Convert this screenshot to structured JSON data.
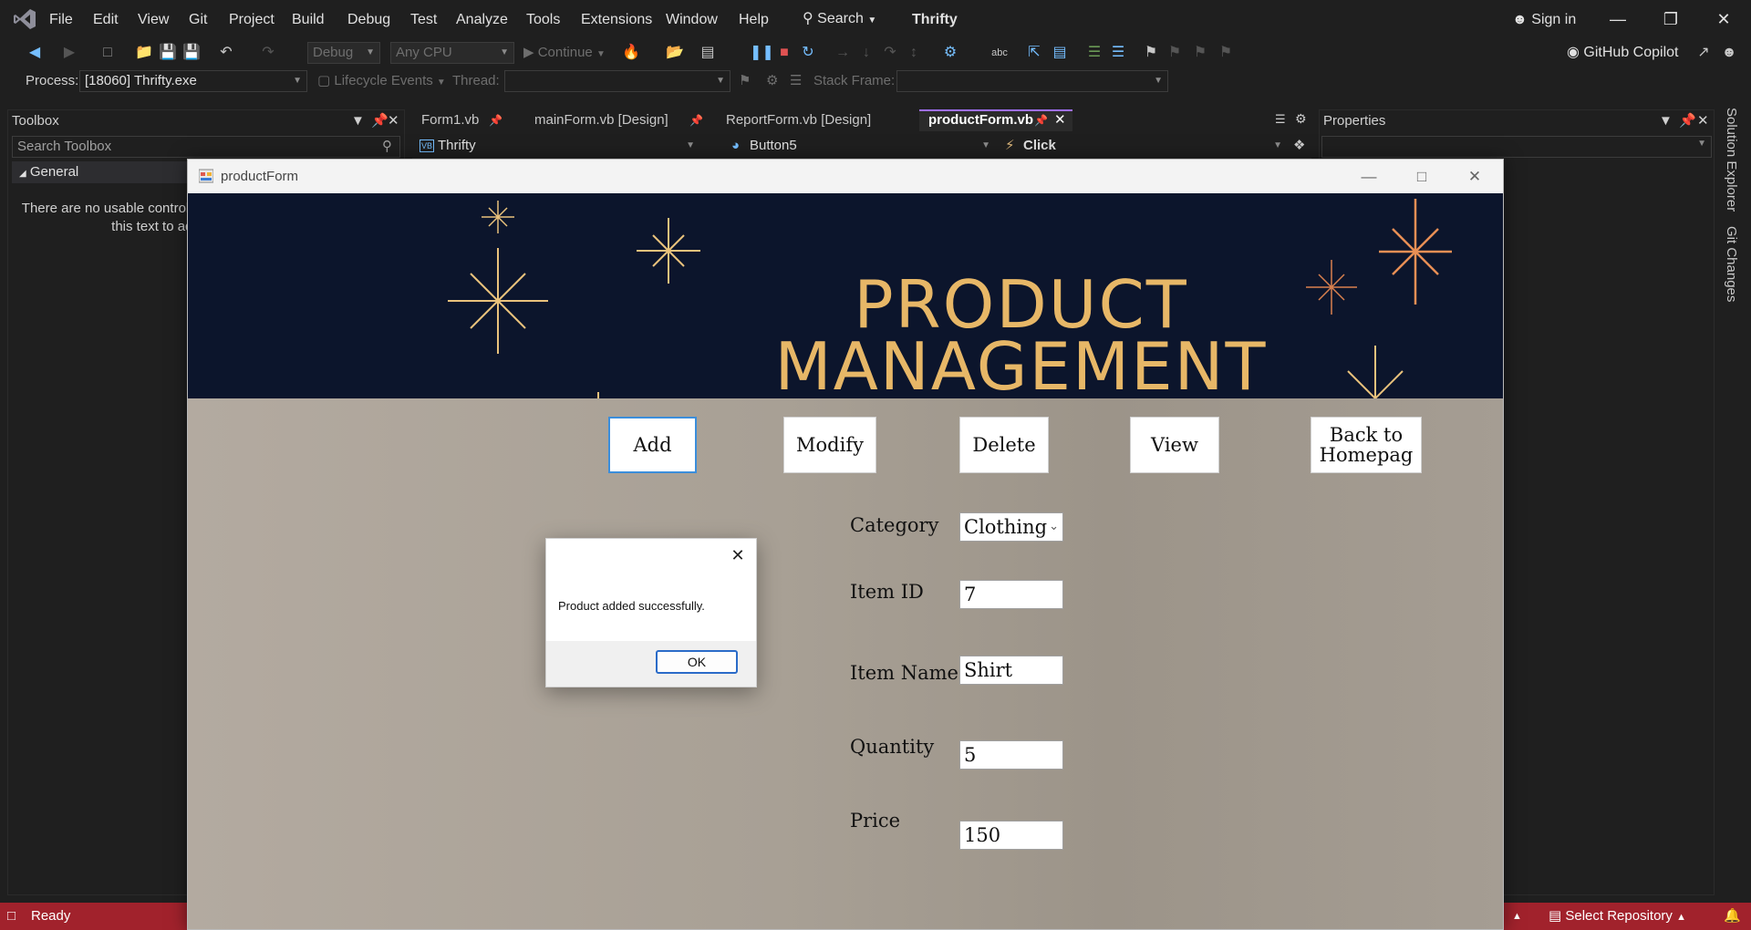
{
  "titlebar": {
    "menu": [
      "File",
      "Edit",
      "View",
      "Git",
      "Project",
      "Build",
      "Debug",
      "Test",
      "Analyze",
      "Tools",
      "Extensions",
      "Window",
      "Help"
    ],
    "search_label": "Search",
    "app_title": "Thrifty",
    "sign_in": "Sign in"
  },
  "toolbar": {
    "config": "Debug",
    "platform": "Any CPU",
    "continue_label": "Continue",
    "copilot_label": "GitHub Copilot"
  },
  "debugbar": {
    "process_label": "Process:",
    "process_value": "[18060] Thrifty.exe",
    "lifecycle_label": "Lifecycle Events",
    "thread_label": "Thread:",
    "stack_frame_label": "Stack Frame:"
  },
  "toolbox": {
    "title": "Toolbox",
    "search_placeholder": "Search Toolbox",
    "group": "General",
    "empty_message_line1": "There are no usable controls in this group. Drag an item onto",
    "empty_message_line2": "this text to add it to the toolbox."
  },
  "editor": {
    "tabs": [
      "Form1.vb",
      "mainForm.vb [Design]",
      "ReportForm.vb [Design]",
      "productForm.vb"
    ],
    "active_tab": "productForm.vb",
    "nav_project": "Thrifty",
    "nav_object": "Button5",
    "nav_event": "Click"
  },
  "properties": {
    "title": "Properties"
  },
  "side_tabs": [
    "Solution Explorer",
    "Git Changes"
  ],
  "statusbar": {
    "status": "Ready",
    "repo": "Select Repository"
  },
  "product_form": {
    "window_title": "productForm",
    "banner_line1": "PRODUCT",
    "banner_line2": "MANAGEMENT",
    "buttons": {
      "add": "Add",
      "modify": "Modify",
      "delete": "Delete",
      "view": "View",
      "back": "Back to Homepag"
    },
    "fields": {
      "category_label": "Category",
      "category_value": "Clothing",
      "item_id_label": "Item ID",
      "item_id_value": "7",
      "item_name_label": "Item Name",
      "item_name_value": "Shirt",
      "quantity_label": "Quantity",
      "quantity_value": "5",
      "price_label": "Price",
      "price_value": "150"
    }
  },
  "message_box": {
    "text": "Product added successfully.",
    "ok_label": "OK"
  }
}
